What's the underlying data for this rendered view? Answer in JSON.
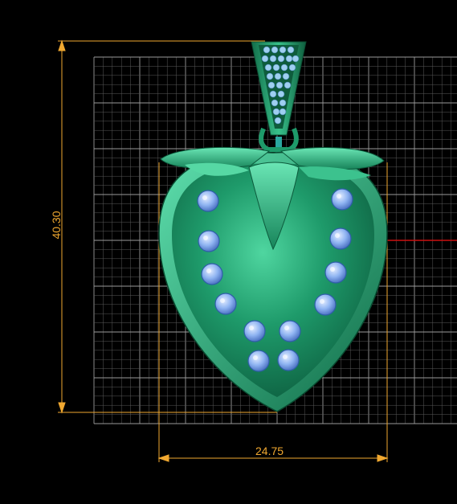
{
  "viewport": {
    "background_color": "#000000",
    "grid_color": "#7a7a7a",
    "dimension_color": "#f0a830",
    "axis_color": "#cc1111"
  },
  "model": {
    "metal_color": "#1e9a6a",
    "stone_color": "#8fb4f2",
    "stone_count": 12,
    "bail_stone_color": "#9ecff0"
  },
  "dimensions": {
    "height_value": "40.30",
    "width_value": "24.75"
  }
}
